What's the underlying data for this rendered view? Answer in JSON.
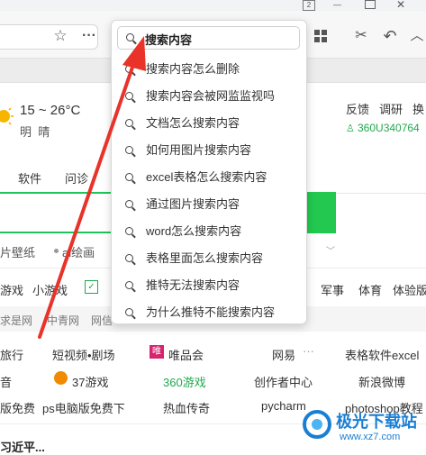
{
  "browser": {
    "window_badge": "2",
    "toolbar_icons": [
      "star-icon",
      "more-icon",
      "grid-icon",
      "scissors-icon",
      "undo-icon",
      "collapse-icon"
    ]
  },
  "page": {
    "weather": {
      "temp": "15 ~ 26°C",
      "desc": "明  晴"
    },
    "top_links": [
      "反馈",
      "调研",
      "换"
    ],
    "user_id": "360U340764",
    "tabs": [
      "软件",
      "问诊"
    ],
    "tags": [
      "片壁纸",
      "ai绘画"
    ],
    "nav_row": [
      "游戏",
      "小游戏",
      "军事",
      "体育",
      "体验版"
    ],
    "grey_row": [
      "求是网",
      "中青网",
      "网信"
    ],
    "links_row1": [
      "旅行",
      "短视频•剧场",
      "唯品会",
      "网易",
      "表格软件excel"
    ],
    "links_row2": [
      "音",
      "37游戏",
      "360游戏",
      "创作者中心",
      "新浪微博"
    ],
    "links_row3": [
      "版免费",
      "ps电脑版免费下",
      "热血传奇",
      "pycharm",
      "photoshop教程"
    ],
    "bottom_text": "习近平..."
  },
  "search_dropdown": {
    "query": "搜索内容",
    "suggestions": [
      "搜索内容怎么删除",
      "搜索内容会被网监监视吗",
      "文档怎么搜索内容",
      "如何用图片搜索内容",
      "excel表格怎么搜索内容",
      "通过图片搜索内容",
      "word怎么搜索内容",
      "表格里面怎么搜索内容",
      "推特无法搜索内容",
      "为什么推特不能搜索内容"
    ]
  },
  "watermark": {
    "title": "极光下载站",
    "url": "www.xz7.com"
  },
  "colors": {
    "accent_green": "#22c84f",
    "arrow_red": "#e8322a",
    "link_green": "#20a94e"
  }
}
